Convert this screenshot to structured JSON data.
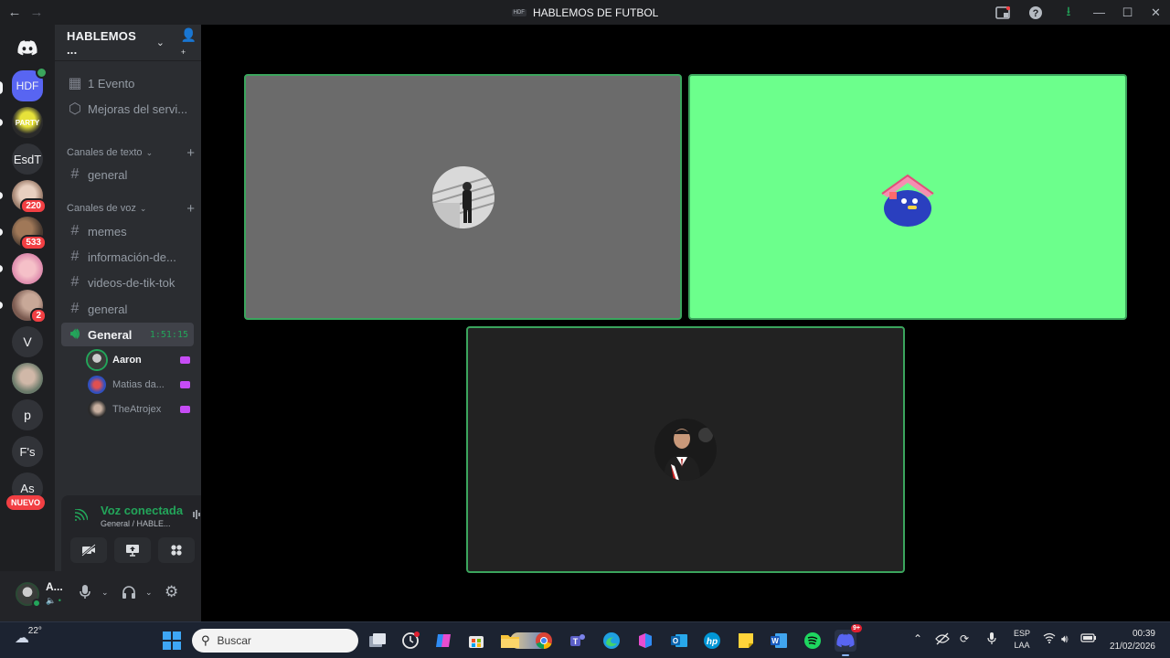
{
  "titlebar": {
    "icon_text": "HDF",
    "title": "HABLEMOS DE FUTBOL"
  },
  "servers": {
    "items": [
      {
        "label": "HDF",
        "badge": "",
        "active": true
      },
      {
        "label": "PARTY",
        "badge": ""
      },
      {
        "label": "EsdT",
        "badge": ""
      },
      {
        "label": "",
        "badge": "220"
      },
      {
        "label": "",
        "badge": "533"
      },
      {
        "label": "",
        "badge": ""
      },
      {
        "label": "",
        "badge": "2"
      },
      {
        "label": "V",
        "badge": ""
      },
      {
        "label": "",
        "badge": ""
      },
      {
        "label": "p",
        "badge": ""
      },
      {
        "label": "F's",
        "badge": ""
      },
      {
        "label": "As",
        "badge": ""
      }
    ],
    "new_badge": "NUEVO"
  },
  "guild": {
    "name": "HABLEMOS ...",
    "events": "1 Evento",
    "boost": "Mejoras del servi...",
    "text_category": "Canales de texto",
    "voice_category": "Canales de voz",
    "text_channels": [
      "general"
    ],
    "voice_list_channels": [
      "memes",
      "información-de...",
      "videos-de-tik-tok",
      "general"
    ],
    "active_voice": {
      "name": "General",
      "timer": "1:51:15"
    },
    "voice_users": [
      {
        "name": "Aaron"
      },
      {
        "name": "Matias da..."
      },
      {
        "name": "TheAtrojex"
      }
    ]
  },
  "voice_panel": {
    "status": "Voz conectada",
    "subtitle": "General / HABLE..."
  },
  "userbar": {
    "name": "A...",
    "status": "🔈 •"
  },
  "colors": {
    "accent_green": "#23a55a",
    "speaking_border": "#3ba55d",
    "tile_gray": "#6b6b6b",
    "tile_green": "#6cff8c",
    "tile_dark": "#222222"
  },
  "taskbar": {
    "weather": "22°",
    "search_placeholder": "Buscar",
    "lang_top": "ESP",
    "lang_bottom": "LAA",
    "time": "00:39",
    "date": "21/02/2026",
    "discord_badge": "9+"
  }
}
